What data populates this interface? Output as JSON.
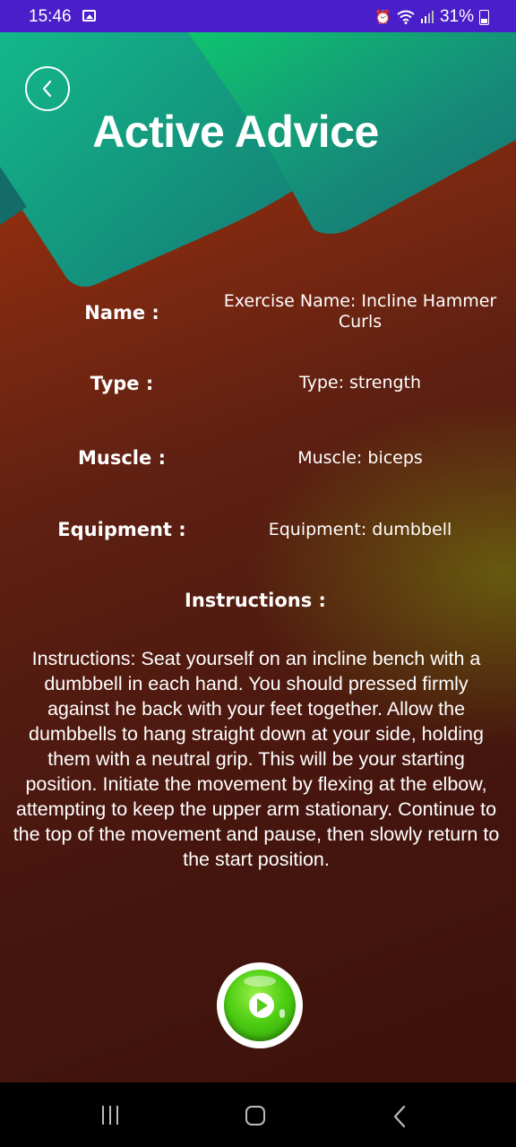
{
  "status_bar": {
    "time": "15:46",
    "battery": "31%",
    "icons": [
      "image-icon",
      "alarm-icon",
      "wifi-icon",
      "signal-icon",
      "battery-icon"
    ]
  },
  "header": {
    "title": "Active Advice",
    "back_icon": "chevron-left-icon",
    "colors": {
      "teal_light": "#12c07a",
      "teal_dark": "#157a78"
    }
  },
  "details": [
    {
      "label": "Name :",
      "value": "Exercise Name: Incline Hammer Curls"
    },
    {
      "label": "Type :",
      "value": "Type: strength"
    },
    {
      "label": "Muscle :",
      "value": "Muscle: biceps"
    },
    {
      "label": "Equipment :",
      "value": "Equipment: dumbbell"
    }
  ],
  "instructions": {
    "heading": "Instructions :",
    "text": "Instructions: Seat yourself on an incline bench with a dumbbell in each hand. You should pressed firmly against he back with your feet together. Allow the dumbbells to hang straight down at your side, holding them with a neutral grip. This will be your starting position. Initiate the movement by flexing at the elbow, attempting to keep the upper arm stationary. Continue to the top of the movement and pause, then slowly return to the start position."
  },
  "play_button": {
    "icon": "play-icon",
    "color": "#4fcf14"
  },
  "nav_bar": {
    "icons": [
      "recents-icon",
      "home-icon",
      "back-icon"
    ]
  }
}
